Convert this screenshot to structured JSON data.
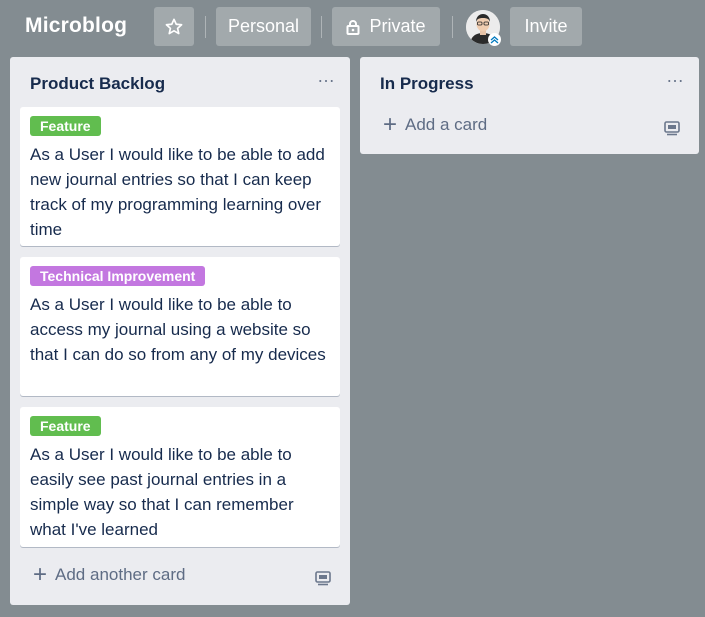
{
  "board": {
    "title": "Microblog",
    "visibility_team": "Personal",
    "visibility_private": "Private",
    "invite_label": "Invite",
    "star_icon": "star-icon",
    "lock_icon": "lock-icon"
  },
  "lists": [
    {
      "title": "Product Backlog",
      "menu": "…",
      "cards": [
        {
          "label": "Feature",
          "label_color": "#61bd4f",
          "text": "As a User I would like to be able to add new journal entries so that I can keep track of my programming learning over time"
        },
        {
          "label": "Technical Improvement",
          "label_color": "#c377e0",
          "text": "As a User I would like to be able to access my journal using a website so that I can do so from any of my devices"
        },
        {
          "label": "Feature",
          "label_color": "#61bd4f",
          "text": "As a User I would like to be able to easily see past journal entries in a simple way so that I can remember what I've learned"
        }
      ],
      "add_label": "Add another card"
    },
    {
      "title": "In Progress",
      "menu": "…",
      "cards": [],
      "add_label": "Add a card"
    }
  ],
  "colors": {
    "board_background": "#838c91",
    "list_background": "#ebecf0",
    "text": "#172b4d"
  }
}
